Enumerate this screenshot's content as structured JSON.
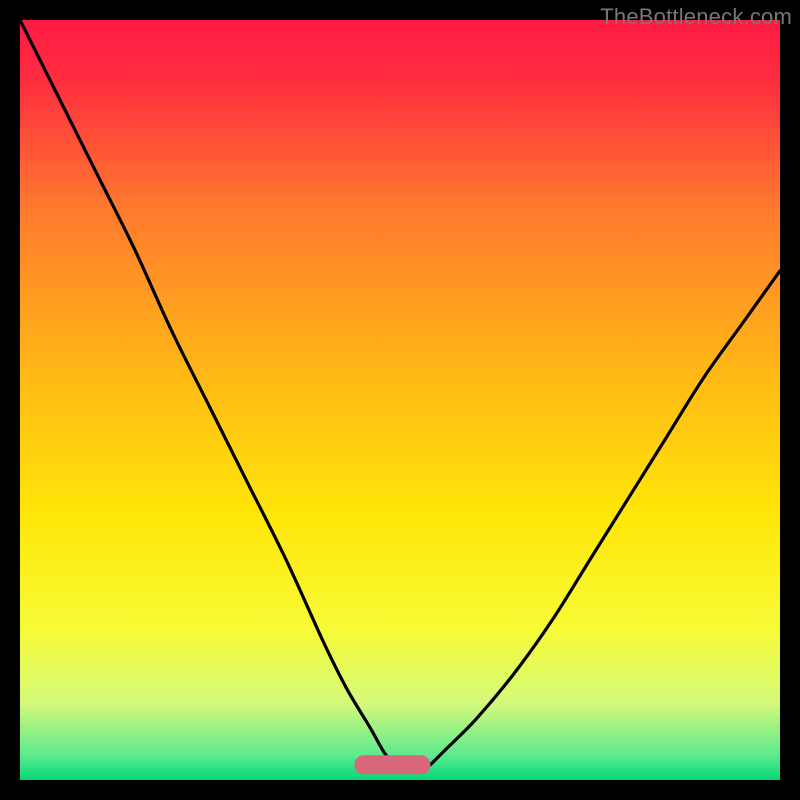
{
  "watermark": "TheBottleneck.com",
  "chart_data": {
    "type": "line",
    "title": "",
    "xlabel": "",
    "ylabel": "",
    "xlim": [
      0,
      100
    ],
    "ylim": [
      0,
      100
    ],
    "background_gradient": {
      "stops": [
        {
          "offset": 0.0,
          "color": "#ff1a44"
        },
        {
          "offset": 0.08,
          "color": "#ff2e3f"
        },
        {
          "offset": 0.25,
          "color": "#ff7a2e"
        },
        {
          "offset": 0.45,
          "color": "#ffb417"
        },
        {
          "offset": 0.65,
          "color": "#ffe608"
        },
        {
          "offset": 0.8,
          "color": "#f8fb36"
        },
        {
          "offset": 0.9,
          "color": "#d3f97a"
        },
        {
          "offset": 0.97,
          "color": "#59e98f"
        },
        {
          "offset": 1.0,
          "color": "#00d877"
        }
      ]
    },
    "marker": {
      "x": 49,
      "y": 2,
      "w": 10,
      "h": 2.5,
      "rx": 1.2,
      "color": "#d9677a"
    },
    "series": [
      {
        "name": "left-branch",
        "x": [
          0,
          5,
          10,
          15,
          20,
          25,
          30,
          35,
          40,
          43,
          46,
          48,
          49.5
        ],
        "y": [
          100,
          90,
          80,
          70,
          59,
          49,
          39,
          29,
          18,
          12,
          7,
          3.5,
          2
        ]
      },
      {
        "name": "right-branch",
        "x": [
          54,
          56,
          60,
          65,
          70,
          75,
          80,
          85,
          90,
          95,
          100
        ],
        "y": [
          2,
          4,
          8,
          14,
          21,
          29,
          37,
          45,
          53,
          60,
          67
        ]
      }
    ]
  }
}
